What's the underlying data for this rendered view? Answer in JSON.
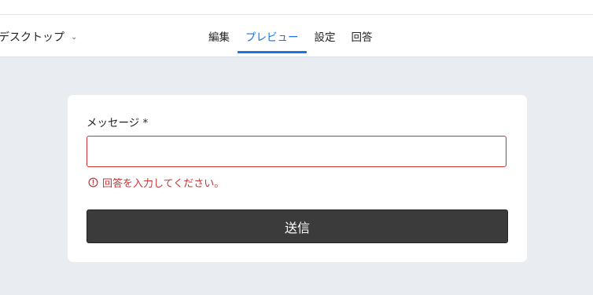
{
  "header": {
    "device_selector": "デスクトップ",
    "tabs": [
      {
        "label": "編集"
      },
      {
        "label": "プレビュー"
      },
      {
        "label": "設定"
      },
      {
        "label": "回答"
      }
    ],
    "active_tab": "プレビュー"
  },
  "form": {
    "field_label": "メッセージ *",
    "input_value": "",
    "error_text": "回答を入力してください。",
    "submit_label": "送信"
  },
  "colors": {
    "accent": "#1a73e8",
    "error": "#cc3333",
    "background": "#e9ecf0",
    "submit_bg": "#3b3b3b"
  }
}
